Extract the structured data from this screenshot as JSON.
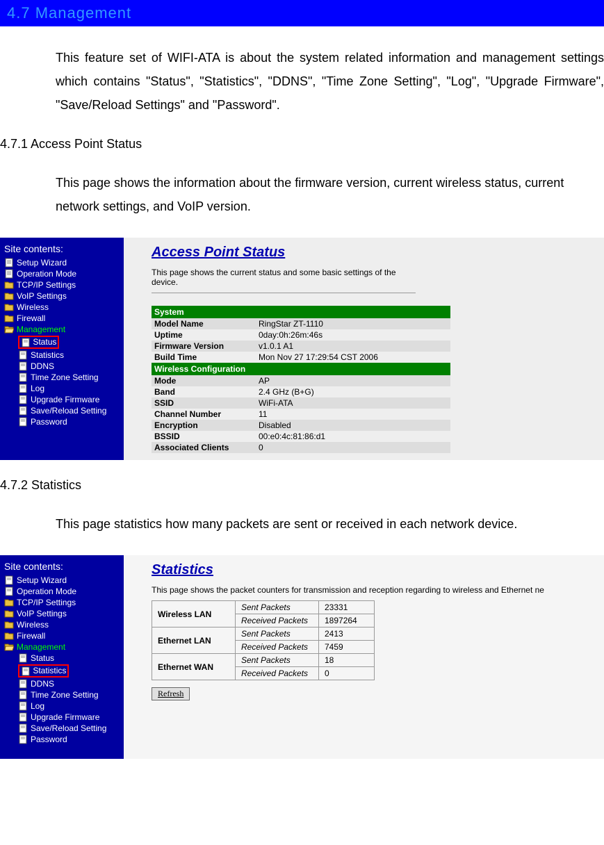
{
  "header": {
    "title": "4.7   Management"
  },
  "paragraphs": {
    "intro": "This feature set of WIFI-ATA is about the system related information and management settings which contains \"Status\", \"Statistics\", \"DDNS\", \"Time Zone Setting\", \"Log\", \"Upgrade Firmware\", \"Save/Reload Settings\" and \"Password\".",
    "sub1_title": "4.7.1 Access Point Status",
    "sub1_body": "This page shows the information about the firmware version, current wireless status, current network settings, and VoIP version.",
    "sub2_title": "4.7.2 Statistics",
    "sub2_body": "This page statistics how many packets are sent or received in each network device."
  },
  "sidebar": {
    "title": "Site contents:",
    "items": [
      {
        "label": "Setup Wizard",
        "type": "file"
      },
      {
        "label": "Operation Mode",
        "type": "file"
      },
      {
        "label": "TCP/IP Settings",
        "type": "folder"
      },
      {
        "label": "VoIP Settings",
        "type": "folder"
      },
      {
        "label": "Wireless",
        "type": "folder"
      },
      {
        "label": "Firewall",
        "type": "folder"
      },
      {
        "label": "Management",
        "type": "folder",
        "class": "mgmt-label"
      }
    ],
    "children": [
      {
        "label": "Status"
      },
      {
        "label": "Statistics"
      },
      {
        "label": "DDNS"
      },
      {
        "label": "Time Zone Setting"
      },
      {
        "label": "Log"
      },
      {
        "label": "Upgrade Firmware"
      },
      {
        "label": "Save/Reload Setting"
      },
      {
        "label": "Password"
      }
    ]
  },
  "ap_status": {
    "title": "Access Point Status",
    "desc": "This page shows the current status and some basic settings of the device.",
    "headers": {
      "system": "System",
      "wireless": "Wireless Configuration"
    },
    "rows_system": [
      {
        "k": "Model Name",
        "v": "RingStar ZT-1110"
      },
      {
        "k": "Uptime",
        "v": "0day:0h:26m:46s"
      },
      {
        "k": "Firmware Version",
        "v": "v1.0.1 A1"
      },
      {
        "k": "Build Time",
        "v": "Mon Nov 27 17:29:54 CST 2006"
      }
    ],
    "rows_wireless": [
      {
        "k": "Mode",
        "v": "AP"
      },
      {
        "k": "Band",
        "v": "2.4 GHz (B+G)"
      },
      {
        "k": "SSID",
        "v": "WiFi-ATA"
      },
      {
        "k": "Channel Number",
        "v": "11"
      },
      {
        "k": "Encryption",
        "v": "Disabled"
      },
      {
        "k": "BSSID",
        "v": "00:e0:4c:81:86:d1"
      },
      {
        "k": "Associated Clients",
        "v": "0"
      }
    ]
  },
  "stats": {
    "title": "Statistics",
    "desc": "This page shows the packet counters for transmission and reception regarding to wireless and Ethernet ne",
    "labels": {
      "sent": "Sent Packets",
      "recv": "Received Packets"
    },
    "rows": [
      {
        "iface": "Wireless LAN",
        "sent": "23331",
        "recv": "1897264"
      },
      {
        "iface": "Ethernet LAN",
        "sent": "2413",
        "recv": "7459"
      },
      {
        "iface": "Ethernet WAN",
        "sent": "18",
        "recv": "0"
      }
    ],
    "refresh": "Refresh"
  }
}
